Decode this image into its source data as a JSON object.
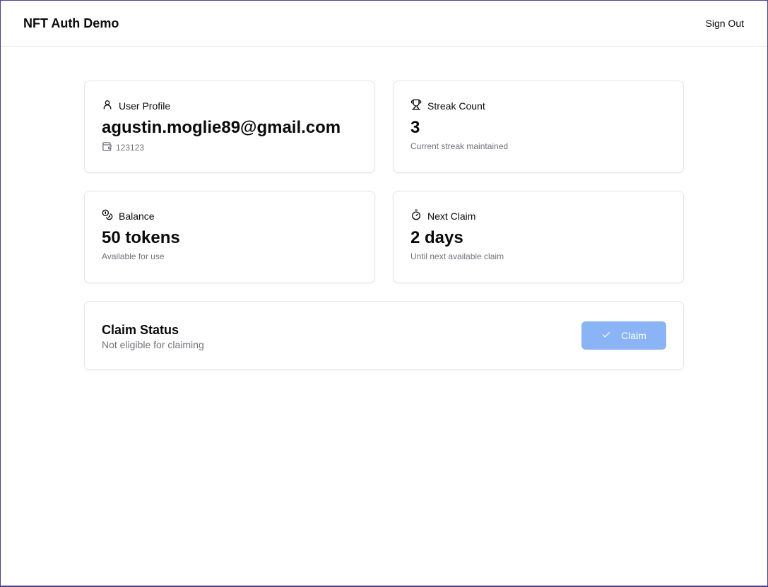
{
  "header": {
    "app_title": "NFT Auth Demo",
    "signout_label": "Sign Out"
  },
  "cards": {
    "profile": {
      "icon": "user-icon",
      "label": "User Profile",
      "value": "agustin.moglie89@gmail.com",
      "wallet_icon": "wallet-icon",
      "wallet": "123123"
    },
    "streak": {
      "icon": "trophy-icon",
      "label": "Streak Count",
      "value": "3",
      "sub": "Current streak maintained"
    },
    "balance": {
      "icon": "coins-icon",
      "label": "Balance",
      "value": "50 tokens",
      "sub": "Available for use"
    },
    "next_claim": {
      "icon": "timer-icon",
      "label": "Next Claim",
      "value": "2 days",
      "sub": "Until next available claim"
    }
  },
  "claim": {
    "title": "Claim Status",
    "status": "Not eligible for claiming",
    "button_icon": "check-icon",
    "button_label": "Claim",
    "button_color": "#8ab4f5"
  }
}
